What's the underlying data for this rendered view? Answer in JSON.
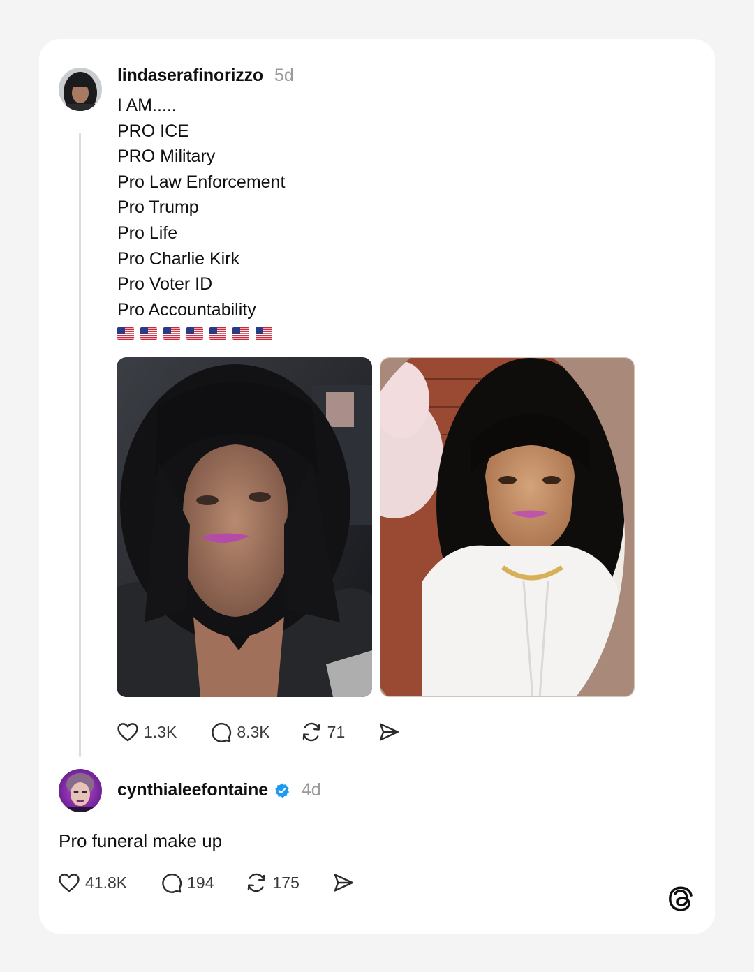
{
  "post": {
    "username": "lindaserafinorizzo",
    "time": "5d",
    "lines": [
      "I AM.....",
      "PRO ICE",
      "PRO Military",
      "Pro Law Enforcement",
      "Pro Trump",
      "Pro Life",
      "Pro Charlie Kirk",
      "Pro Voter ID",
      "Pro Accountability"
    ],
    "flag_emoji": "🇺🇸",
    "flag_count": 7,
    "likes": "1.3K",
    "replies": "8.3K",
    "reposts": "71"
  },
  "reply": {
    "username": "cynthialeefontaine",
    "verified": true,
    "time": "4d",
    "text": "Pro funeral make up",
    "likes": "41.8K",
    "replies": "194",
    "reposts": "175"
  },
  "colors": {
    "accent_verified": "#1d9bf0",
    "muted_text": "#9a9a9a",
    "thread_line": "#dcdcdc"
  },
  "icons": [
    "heart-icon",
    "comment-icon",
    "repost-icon",
    "share-icon",
    "threads-logo"
  ]
}
